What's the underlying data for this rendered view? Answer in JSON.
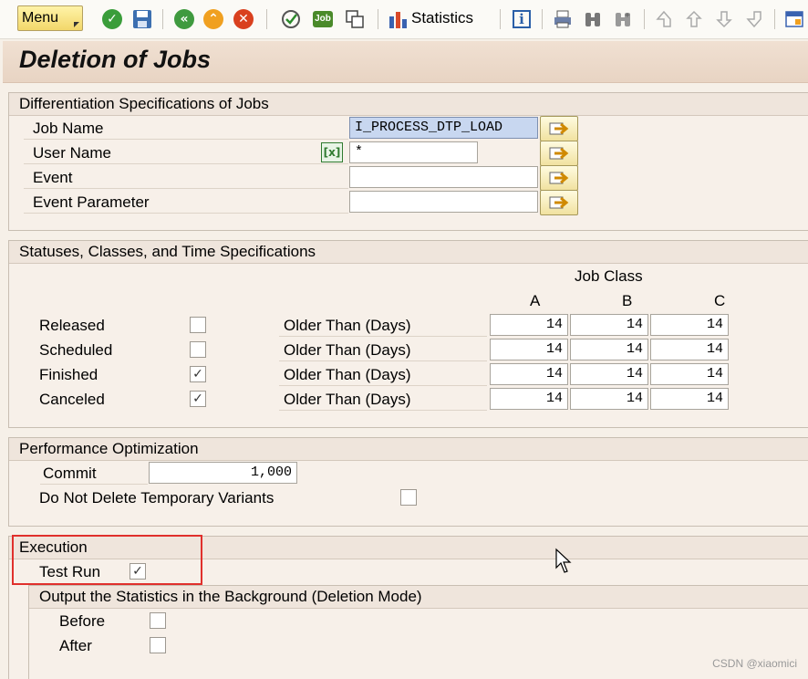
{
  "toolbar": {
    "menu_label": "Menu",
    "statistics_label": "Statistics",
    "job_icon_text": "Job",
    "info_icon_text": "i",
    "icons": [
      "check-icon",
      "save-icon",
      "back-icon",
      "exit-icon",
      "cancel-icon",
      "execute-icon",
      "job-icon",
      "copy-icon",
      "statistics-icon",
      "info-icon",
      "print-icon",
      "find-icon",
      "find-next-icon",
      "first-page-icon",
      "previous-page-icon",
      "next-page-icon",
      "last-page-icon",
      "layout-icon"
    ]
  },
  "title": "Deletion of Jobs",
  "differentiation": {
    "header": "Differentiation Specifications of Jobs",
    "fields": [
      {
        "label": "Job Name",
        "value": "I_PROCESS_DTP_LOAD"
      },
      {
        "label": "User Name",
        "value": "*"
      },
      {
        "label": "Event",
        "value": ""
      },
      {
        "label": "Event Parameter",
        "value": ""
      }
    ],
    "select_options_icon_text": "[x]"
  },
  "statuses": {
    "header": "Statuses, Classes, and Time Specifications",
    "job_class_label": "Job Class",
    "class_headers": [
      "A",
      "B",
      "C"
    ],
    "rows": [
      {
        "status": "Released",
        "checked": false,
        "older_label": "Older Than (Days)",
        "values": [
          "14",
          "14",
          "14"
        ]
      },
      {
        "status": "Scheduled",
        "checked": false,
        "older_label": "Older Than (Days)",
        "values": [
          "14",
          "14",
          "14"
        ]
      },
      {
        "status": "Finished",
        "checked": true,
        "older_label": "Older Than (Days)",
        "values": [
          "14",
          "14",
          "14"
        ]
      },
      {
        "status": "Canceled",
        "checked": true,
        "older_label": "Older Than (Days)",
        "values": [
          "14",
          "14",
          "14"
        ]
      }
    ],
    "check_mark": "✓"
  },
  "performance": {
    "header": "Performance Optimization",
    "commit_label": "Commit",
    "commit_value": "1,000",
    "no_delete_label": "Do Not Delete Temporary Variants",
    "no_delete_checked": false
  },
  "execution": {
    "header": "Execution",
    "test_run_label": "Test Run",
    "test_run_checked": true,
    "output_header": "Output the Statistics in the Background (Deletion Mode)",
    "before_label": "Before",
    "before_checked": false,
    "after_label": "After",
    "after_checked": false
  },
  "watermark": "CSDN @xiaomici"
}
